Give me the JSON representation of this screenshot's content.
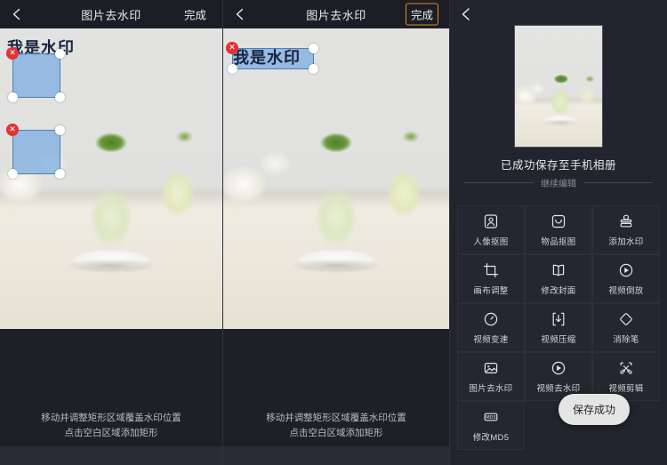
{
  "panel_left": {
    "header": {
      "back_icon": "chevron-left-icon",
      "title": "图片去水印",
      "done_label": "完成"
    },
    "watermark_text": "我是水印",
    "close_glyph": "✕",
    "hint_line1": "移动并调整矩形区域覆盖水印位置",
    "hint_line2": "点击空白区域添加矩形"
  },
  "panel_mid": {
    "header": {
      "back_icon": "chevron-left-icon",
      "title": "图片去水印",
      "done_label": "完成",
      "done_focused": true
    },
    "watermark_text": "我是水印",
    "close_glyph": "✕",
    "hint_line1": "移动并调整矩形区域覆盖水印位置",
    "hint_line2": "点击空白区域添加矩形"
  },
  "panel_right": {
    "back_icon": "chevron-left-icon",
    "saved_message": "已成功保存至手机相册",
    "continue_label": "继续编辑",
    "toast": "保存成功",
    "tools": [
      {
        "icon": "person-cutout-icon",
        "label": "人像抠图"
      },
      {
        "icon": "object-cutout-icon",
        "label": "物品抠图"
      },
      {
        "icon": "stamp-icon",
        "label": "添加水印"
      },
      {
        "icon": "crop-icon",
        "label": "画布调整"
      },
      {
        "icon": "book-cover-icon",
        "label": "修改封面"
      },
      {
        "icon": "play-reverse-icon",
        "label": "视频倒放"
      },
      {
        "icon": "speed-gauge-icon",
        "label": "视频变速"
      },
      {
        "icon": "compress-download-icon",
        "label": "视频压缩"
      },
      {
        "icon": "eraser-icon",
        "label": "消除笔"
      },
      {
        "icon": "image-watermark-icon",
        "label": "图片去水印"
      },
      {
        "icon": "video-watermark-icon",
        "label": "视频去水印"
      },
      {
        "icon": "scissors-icon",
        "label": "视频剪辑"
      },
      {
        "icon": "md5-badge-icon",
        "label": "修改MD5"
      }
    ]
  },
  "colors": {
    "accent": "#e08b22",
    "selection": "#78aae1",
    "close": "#e23232",
    "bg": "#1d2027"
  }
}
